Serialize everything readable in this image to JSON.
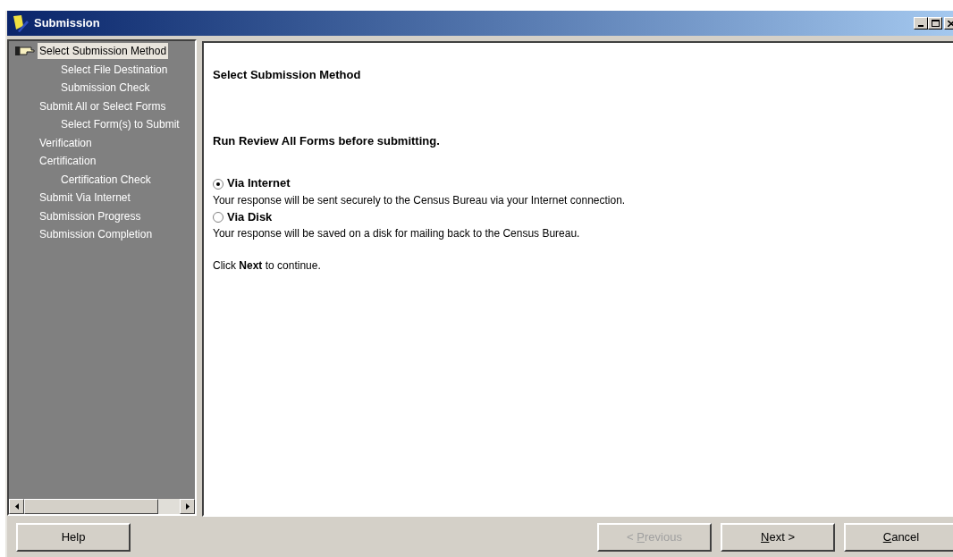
{
  "window": {
    "title": "Submission"
  },
  "sidebar": {
    "items": [
      {
        "label": "Select Submission Method",
        "selected": true,
        "children": [
          {
            "label": "Select File Destination",
            "selected": false
          },
          {
            "label": "Submission Check",
            "selected": false
          }
        ]
      },
      {
        "label": "Submit All or Select Forms",
        "selected": false,
        "children": [
          {
            "label": "Select Form(s) to Submit",
            "selected": false
          }
        ]
      },
      {
        "label": "Verification",
        "selected": false
      },
      {
        "label": "Certification",
        "selected": false,
        "children": [
          {
            "label": "Certification Check",
            "selected": false
          }
        ]
      },
      {
        "label": "Submit Via Internet",
        "selected": false
      },
      {
        "label": "Submission Progress",
        "selected": false
      },
      {
        "label": "Submission Completion",
        "selected": false
      }
    ]
  },
  "content": {
    "heading": "Select Submission Method",
    "instruction": "Run Review All Forms before submitting.",
    "options": [
      {
        "label": "Via Internet",
        "description": "Your response will be sent securely to the Census Bureau via your Internet connection.",
        "selected": true
      },
      {
        "label": "Via Disk",
        "description": "Your response will be saved on a disk for mailing back to the Census Bureau.",
        "selected": false
      }
    ],
    "footer": "Click **Next** to continue."
  },
  "buttons": {
    "left": [
      {
        "before": "Help",
        "disabled": false
      }
    ],
    "right": [
      {
        "before": "< ",
        "mnemonic": "P",
        "after": "revious",
        "disabled": true
      },
      {
        "mnemonic": "N",
        "after": "ext >",
        "disabled": false
      },
      {
        "mnemonic": "C",
        "after": "ancel",
        "disabled": false
      }
    ]
  }
}
